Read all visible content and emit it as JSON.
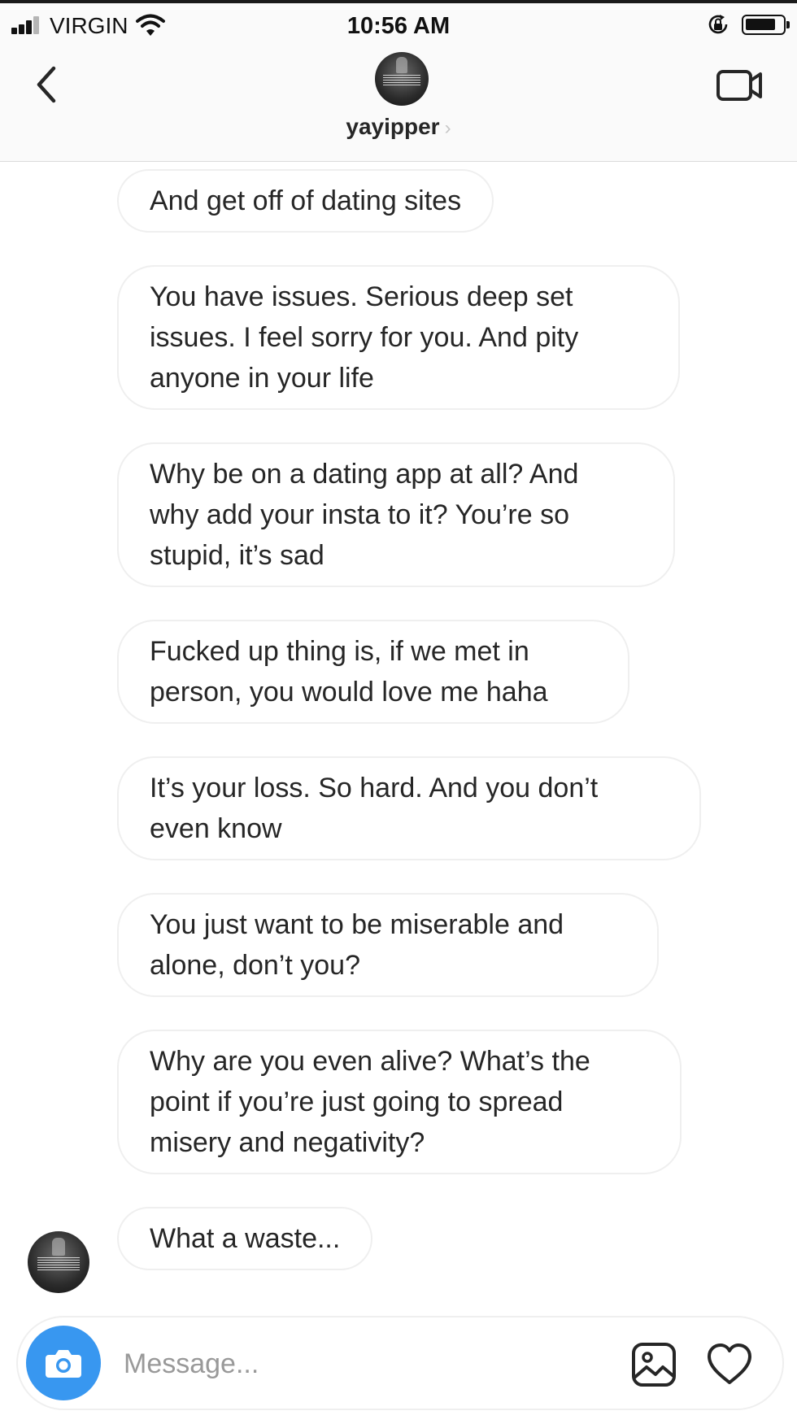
{
  "status_bar": {
    "carrier": "VIRGIN",
    "time": "10:56 AM",
    "icons": [
      "signal-icon",
      "wifi-icon",
      "rotation-lock-icon",
      "battery-icon"
    ]
  },
  "header": {
    "username": "yayipper",
    "chevron": "›",
    "icons": [
      "back-chevron-icon",
      "video-call-icon"
    ]
  },
  "messages": [
    {
      "lines": [
        "And get off of dating sites"
      ]
    },
    {
      "lines": [
        "You have issues. Serious deep set",
        "issues. I feel sorry for you. And pity",
        "anyone in your life"
      ]
    },
    {
      "lines": [
        "Why be on a dating app at all? And",
        "why add your insta to it? You’re so",
        "stupid, it’s sad"
      ]
    },
    {
      "lines": [
        "Fucked up thing is, if we met in",
        "person, you would love me haha"
      ]
    },
    {
      "lines": [
        "It’s your loss. So hard. And you don’t",
        "even know"
      ]
    },
    {
      "lines": [
        "You just want to be miserable and",
        "alone, don’t you?"
      ]
    },
    {
      "lines": [
        "Why are you even alive? What’s the",
        "point if you’re just going to spread",
        "misery and negativity?"
      ]
    },
    {
      "lines": [
        "What a waste..."
      ]
    }
  ],
  "composer": {
    "placeholder": "Message...",
    "value": "",
    "icons": [
      "camera-icon",
      "gallery-icon",
      "heart-icon"
    ],
    "camera_color": "#3897f0"
  }
}
